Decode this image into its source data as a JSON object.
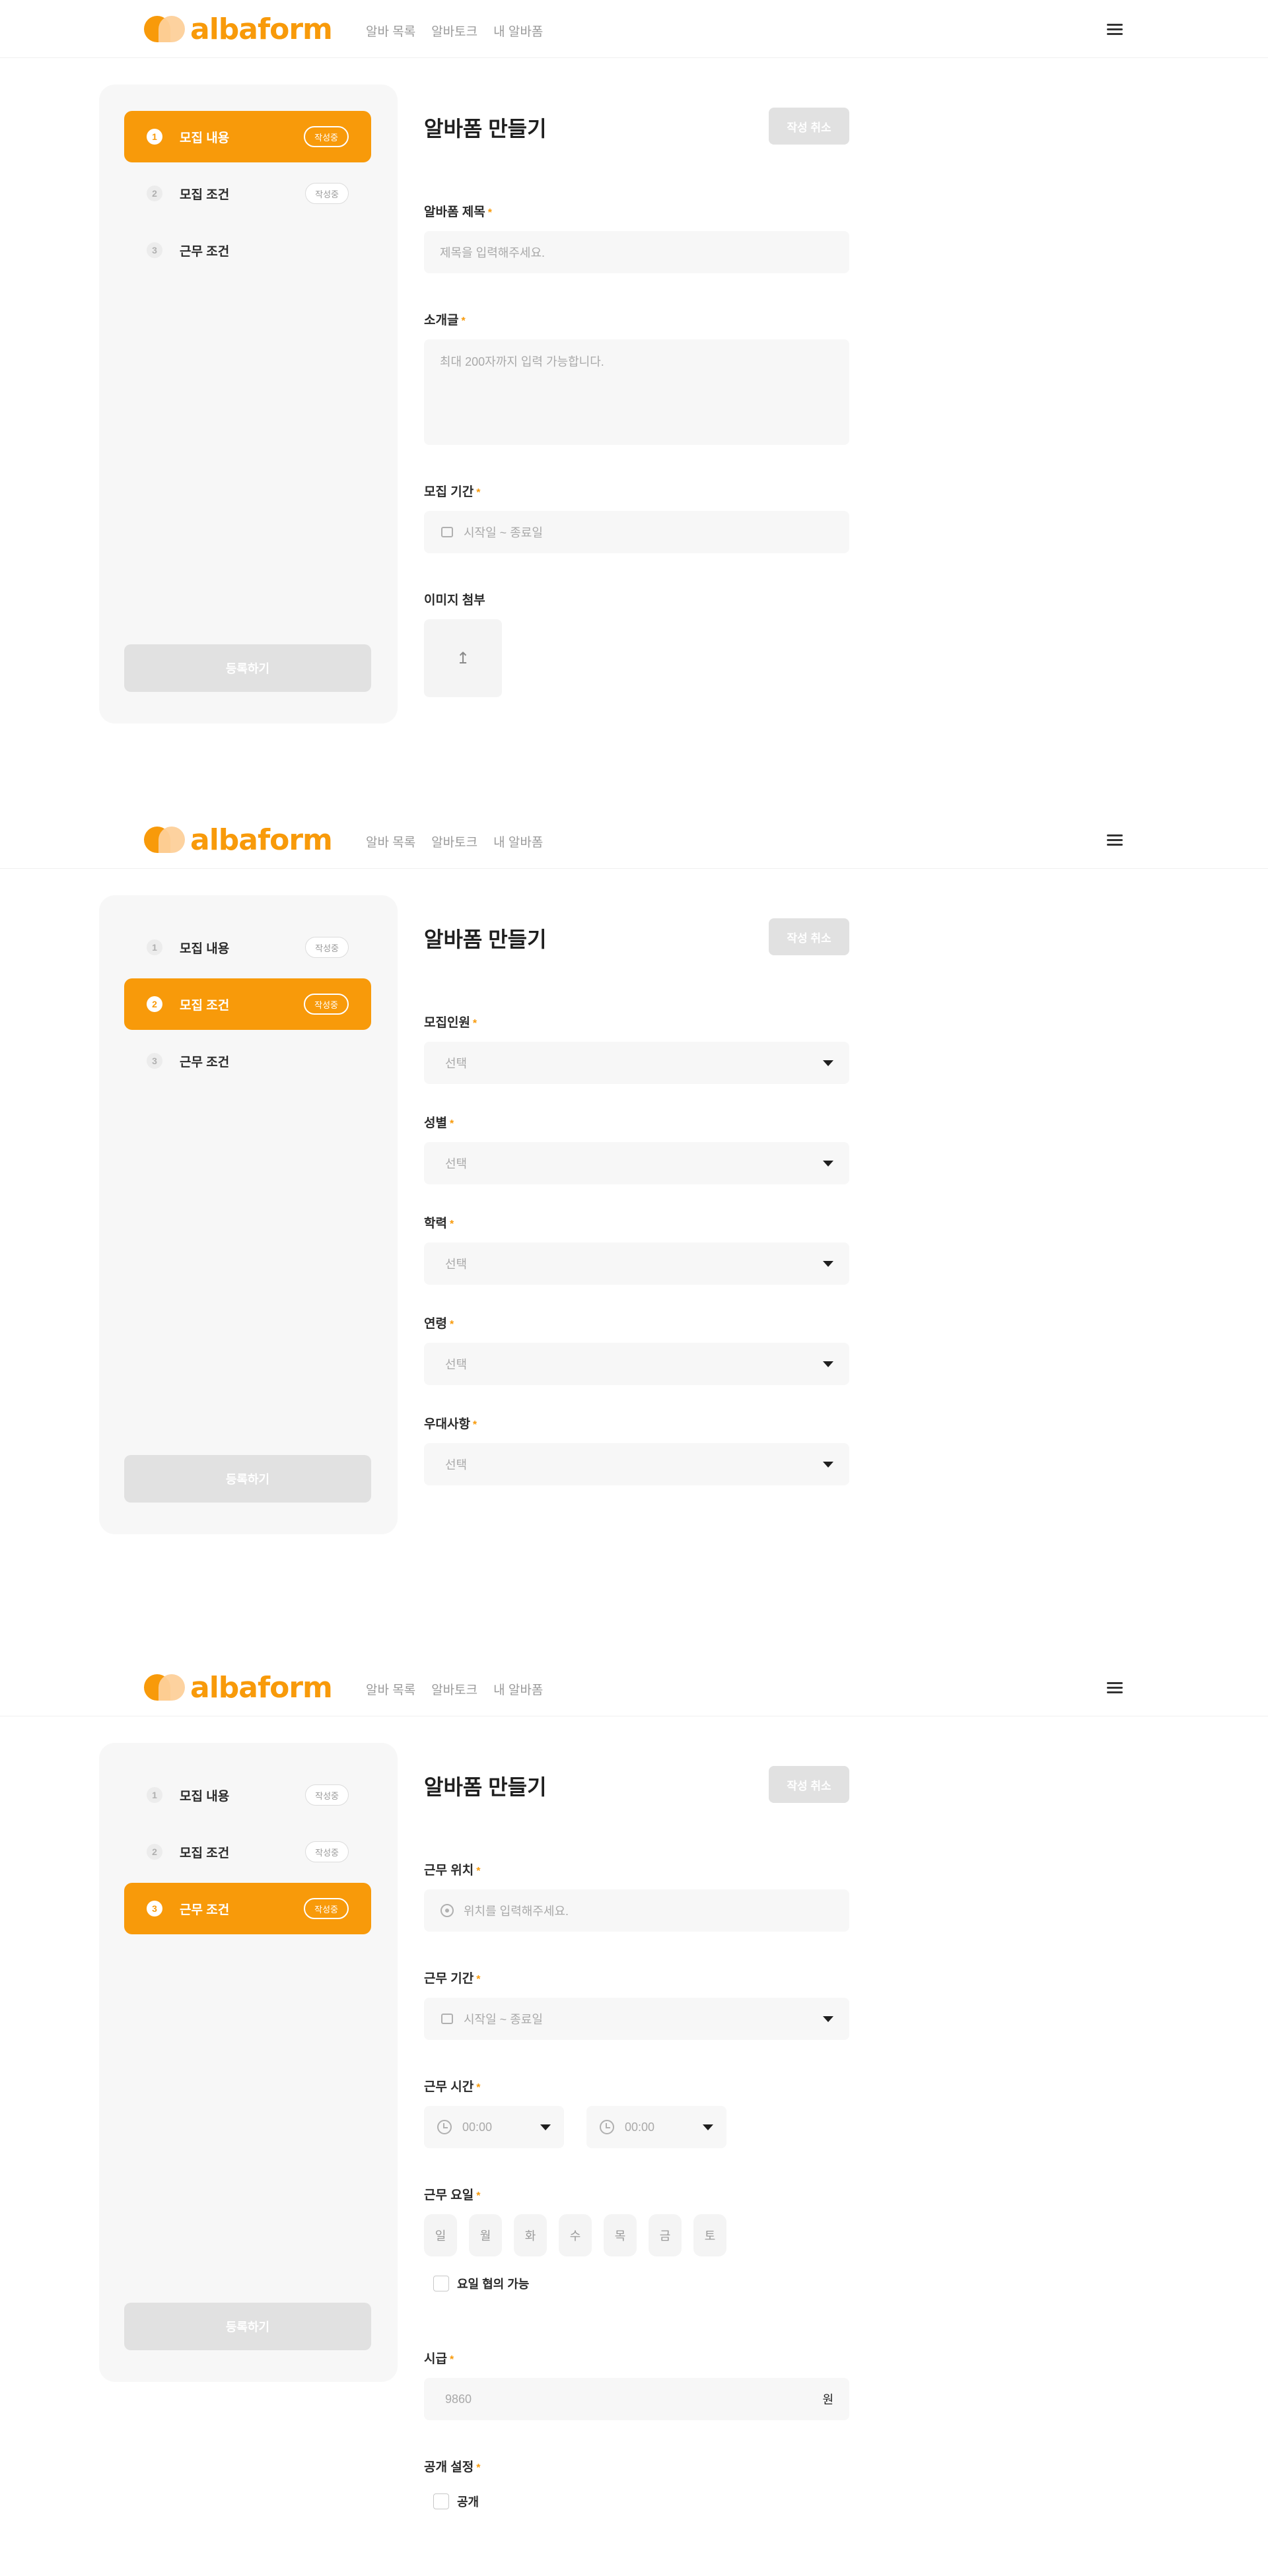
{
  "header": {
    "logo_text": "albaform",
    "nav": [
      "알바 목록",
      "알바토크",
      "내 알바폼"
    ]
  },
  "steps": [
    {
      "num": "1",
      "label": "모집 내용",
      "badge": "작성중"
    },
    {
      "num": "2",
      "label": "모집 조건",
      "badge": "작성중"
    },
    {
      "num": "3",
      "label": "근무 조건",
      "badge": "작성중"
    }
  ],
  "submit_label": "등록하기",
  "page_title": "알바폼 만들기",
  "cancel_label": "작성 취소",
  "required_mark": "*",
  "form1": {
    "title_label": "알바폼 제목",
    "title_placeholder": "제목을 입력해주세요.",
    "intro_label": "소개글",
    "intro_placeholder": "최대 200자까지 입력 가능합니다.",
    "period_label": "모집 기간",
    "period_placeholder": "시작일 ~ 종료일",
    "image_label": "이미지 첨부",
    "upload_glyph": "↥"
  },
  "form2": {
    "fields": [
      {
        "label": "모집인원",
        "value": "선택"
      },
      {
        "label": "성별",
        "value": "선택"
      },
      {
        "label": "학력",
        "value": "선택"
      },
      {
        "label": "연령",
        "value": "선택"
      },
      {
        "label": "우대사항",
        "value": "선택"
      }
    ]
  },
  "form3": {
    "location_label": "근무 위치",
    "location_placeholder": "위치를 입력해주세요.",
    "period_label": "근무 기간",
    "period_placeholder": "시작일 ~ 종료일",
    "time_label": "근무 시간",
    "start_time": "00:00",
    "end_time": "00:00",
    "days_label": "근무 요일",
    "days": [
      "일",
      "월",
      "화",
      "수",
      "목",
      "금",
      "토"
    ],
    "negotiable_label": "요일 협의 가능",
    "wage_label": "시급",
    "wage_value": "9860",
    "wage_unit": "원",
    "public_label": "공개 설정",
    "public_option": "공개"
  },
  "colors": {
    "accent": "#f89a0a",
    "sidebar_bg": "#f7f7f7",
    "disabled_btn": "#e1e1e1"
  }
}
